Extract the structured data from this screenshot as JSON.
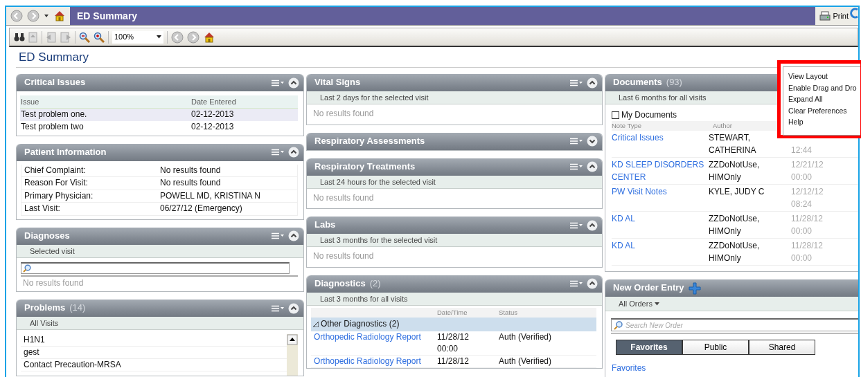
{
  "nav": {
    "title": "ED Summary",
    "print_label": "Print"
  },
  "toolbar": {
    "zoom": "100%"
  },
  "page_title": "ED Summary",
  "columns": [
    [
      {
        "kind": "table",
        "title": "Critical Issues",
        "expanded": true,
        "headers": [
          "Issue",
          "Date Entered"
        ],
        "rows": [
          {
            "cells": [
              "Test problem one.",
              "02-12-2013"
            ],
            "selected": true
          },
          {
            "cells": [
              "Test problem two",
              "02-12-2013"
            ],
            "selected": false
          }
        ]
      },
      {
        "kind": "keyvalue",
        "title": "Patient Information",
        "expanded": true,
        "rows": [
          {
            "label": "Chief Complaint:",
            "value": "No results found"
          },
          {
            "label": "Reason For Visit:",
            "value": "No results found"
          },
          {
            "label": "Primary Physician:",
            "value": "POWELL MD, KRISTINA N"
          },
          {
            "label": "Last Visit:",
            "value": "06/27/12 (Emergency)"
          }
        ]
      },
      {
        "kind": "search",
        "title": "Diagnoses",
        "expanded": true,
        "subtitle": "Selected visit",
        "empty": "No results found"
      },
      {
        "kind": "list",
        "title": "Problems",
        "count": "(14)",
        "expanded": true,
        "subtitle": "All Visits",
        "items": [
          "H1N1",
          "gest",
          "Contact Precaution-MRSA"
        ]
      }
    ],
    [
      {
        "kind": "empty",
        "title": "Vital Signs",
        "expanded": true,
        "subtitle": "Last 2 days for the selected visit",
        "empty": "No results found"
      },
      {
        "kind": "empty",
        "title": "Respiratory Assessments",
        "expanded": false
      },
      {
        "kind": "empty",
        "title": "Respiratory Treatments",
        "expanded": true,
        "subtitle": "Last 24 hours for the selected visit",
        "empty": "No results found"
      },
      {
        "kind": "empty",
        "title": "Labs",
        "expanded": true,
        "subtitle": "Last 3 months for the selected visit",
        "empty": "No results found"
      },
      {
        "kind": "diagnostics",
        "title": "Diagnostics",
        "count": "(2)",
        "expanded": true,
        "subtitle": "Last 3 months for all visits",
        "headers": [
          "Date/Time",
          "Status"
        ],
        "group": {
          "label": "Other Diagnostics (2)",
          "expanded": true
        },
        "rows": [
          {
            "name": "Orthopedic Radiology Report",
            "date": "11/28/12",
            "time": "00:00",
            "status": "Auth (Verified)"
          },
          {
            "name": "Orthopedic Radiology Report",
            "date": "11/28/12",
            "status": "Auth (Verified)"
          }
        ]
      }
    ],
    [
      {
        "kind": "documents",
        "title": "Documents",
        "count": "(93)",
        "subtitle": "Last 6 months for all visits",
        "my_documents": {
          "label": "My Documents",
          "checked": false
        },
        "headers": [
          "Note Type",
          "Author"
        ],
        "rows": [
          {
            "note": "Critical Issues",
            "author": "STEWART, CATHERINA",
            "time": "12:44"
          },
          {
            "note": "KD SLEEP DISORDERS CENTER",
            "author": "ZZDoNotUse, HIMOnly",
            "date": "12/21/12",
            "time": "00:00"
          },
          {
            "note": "PW Visit Notes",
            "author": "KYLE, JUDY C",
            "date": "12/12/12",
            "time": "08:24"
          },
          {
            "note": "KD AL",
            "author": "ZZDoNotUse, HIMOnly",
            "date": "11/28/12",
            "time": "00:00"
          },
          {
            "note": "KD AL",
            "author": "ZZDoNotUse, HIMOnly",
            "date": "11/28/12",
            "time": "00:00"
          }
        ]
      },
      {
        "kind": "orders",
        "title": "New Order Entry",
        "filter": "All Orders",
        "search_placeholder": "Search New Order",
        "tabs": [
          {
            "label": "Favorites",
            "selected": true
          },
          {
            "label": "Public",
            "selected": false
          },
          {
            "label": "Shared",
            "selected": false
          }
        ],
        "link": "Favorites"
      }
    ]
  ],
  "context_menu": {
    "items": [
      "View Layout",
      "Enable Drag and Dro",
      "Expand All",
      "Clear Preferences",
      "Help"
    ]
  }
}
